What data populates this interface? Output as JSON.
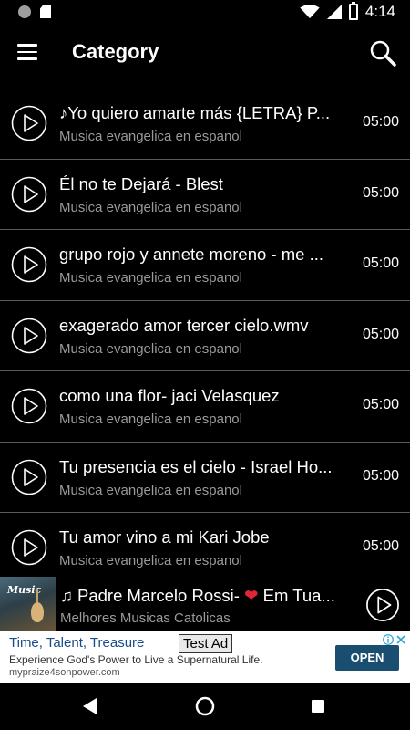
{
  "status_bar": {
    "time": "4:14"
  },
  "app_bar": {
    "title": "Category"
  },
  "list": [
    {
      "title": "♪Yo quiero amarte más {LETRA} P...",
      "subtitle": "Musica evangelica en espanol",
      "duration": "05:00"
    },
    {
      "title": "Él no te Dejará - Blest",
      "subtitle": "Musica evangelica en espanol",
      "duration": "05:00"
    },
    {
      "title": "grupo rojo y annete moreno - me ...",
      "subtitle": "Musica evangelica en espanol",
      "duration": "05:00"
    },
    {
      "title": "exagerado amor tercer cielo.wmv",
      "subtitle": "Musica evangelica en espanol",
      "duration": "05:00"
    },
    {
      "title": "como una flor- jaci Velasquez",
      "subtitle": "Musica evangelica en espanol",
      "duration": "05:00"
    },
    {
      "title": "Tu presencia es el cielo -  Israel Ho...",
      "subtitle": "Musica evangelica en espanol",
      "duration": "05:00"
    },
    {
      "title": "Tu amor vino a mi Kari Jobe",
      "subtitle": "Musica evangelica en espanol",
      "duration": "05:00"
    }
  ],
  "mini_player": {
    "title_before": "♫ Padre Marcelo Rossi- ",
    "heart": "❤",
    "title_after": " Em Tua...",
    "subtitle": "Melhores Musicas Catolicas",
    "thumbnail_text": "Music"
  },
  "ad": {
    "title": "Time, Talent, Treasure",
    "badge": "Test Ad",
    "description": "Experience God's Power to Live a Supernatural Life.",
    "url": "mypraize4sonpower.com",
    "cta": "OPEN"
  },
  "colors": {
    "background": "#000000",
    "subtitle": "#9a9a9a",
    "divider": "#5a5a5a",
    "heart": "#e0263a",
    "ad_button": "#1a4e70"
  }
}
